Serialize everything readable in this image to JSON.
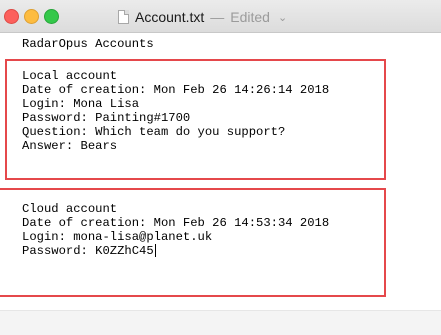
{
  "window": {
    "filename": "Account.txt",
    "separator": "—",
    "status": "Edited",
    "chevron": "⌄"
  },
  "document": {
    "header": "RadarOpus Accounts",
    "local": {
      "title": "Local account",
      "created": "Date of creation: Mon Feb 26 14:26:14 2018",
      "login": "Login: Mona Lisa",
      "password": "Password: Painting#1700",
      "question": "Question: Which team do you support?",
      "answer": "Answer: Bears"
    },
    "cloud": {
      "title": "Cloud account",
      "created": "Date of creation: Mon Feb 26 14:53:34 2018",
      "login": "Login: mona-lisa@planet.uk",
      "password": "Password: K0ZZhC45"
    }
  },
  "colors": {
    "highlight_box": "#e5484b",
    "close": "#fc605c",
    "minimize": "#fdbc40",
    "zoom": "#34c84a"
  },
  "icons": [
    "close-icon",
    "minimize-icon",
    "zoom-icon",
    "document-icon",
    "chevron-down-icon"
  ]
}
